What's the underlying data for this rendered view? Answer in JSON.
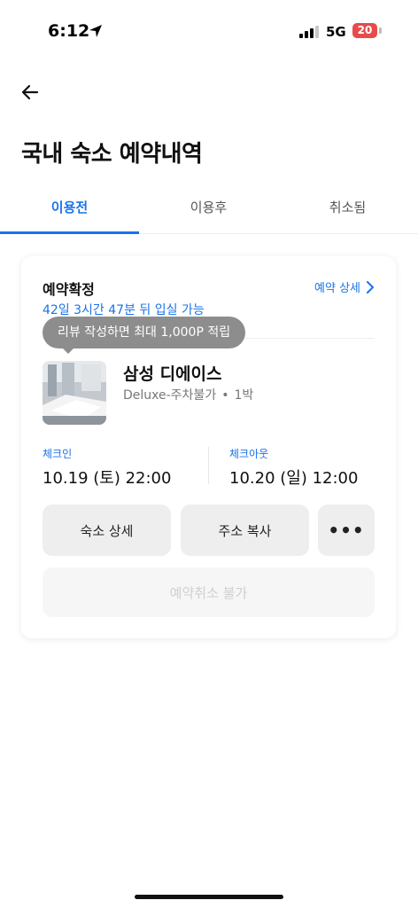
{
  "status_bar": {
    "time": "6:12",
    "network": "5G",
    "battery": "20"
  },
  "header": {
    "title": "국내 숙소 예약내역"
  },
  "tabs": [
    {
      "label": "이용전",
      "active": true
    },
    {
      "label": "이용후",
      "active": false
    },
    {
      "label": "취소됨",
      "active": false
    }
  ],
  "reservation": {
    "status": "예약확정",
    "detail_link": "예약 상세",
    "countdown": "42일 3시간 47분 뒤 입실 가능",
    "tooltip": "리뷰 작성하면 최대 1,000P 적립",
    "hotel_name": "삼성 디에이스",
    "room_type": "Deluxe-주차불가",
    "nights": "1박",
    "checkin_label": "체크인",
    "checkin_value": "10.19 (토) 22:00",
    "checkout_label": "체크아웃",
    "checkout_value": "10.20 (일) 12:00",
    "buttons": {
      "hotel_detail": "숙소 상세",
      "copy_address": "주소 복사",
      "more": "•••"
    },
    "cancel_label": "예약취소 불가"
  },
  "colors": {
    "accent": "#1a73e8",
    "battery": "#e74b4b"
  }
}
